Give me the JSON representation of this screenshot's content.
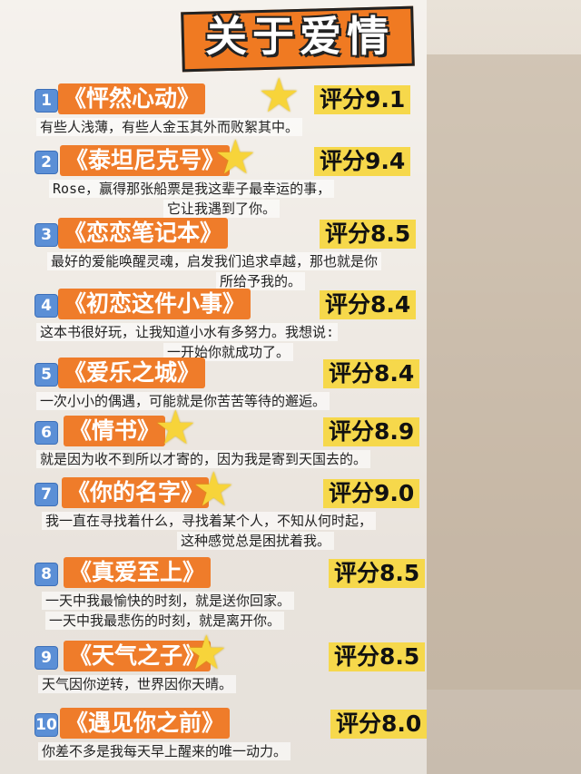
{
  "title": "关于爱情",
  "colors": {
    "accent": "#ef7c2a",
    "score_bg": "#f6d84b",
    "number_badge": "#5b8fd6"
  },
  "movies": [
    {
      "num": "1",
      "name": "《怦然心动》",
      "score": "评分9.1",
      "star": true,
      "lines": [
        "有些人浅薄，有些人金玉其外而败絮其中。"
      ]
    },
    {
      "num": "2",
      "name": "《泰坦尼克号》",
      "score": "评分9.4",
      "star": true,
      "lines": [
        "Rose，赢得那张船票是我这辈子最幸运的事，",
        "它让我遇到了你。"
      ]
    },
    {
      "num": "3",
      "name": "《恋恋笔记本》",
      "score": "评分8.5",
      "star": false,
      "lines": [
        "最好的爱能唤醒灵魂，启发我们追求卓越，那也就是你",
        "所给予我的。"
      ]
    },
    {
      "num": "4",
      "name": "《初恋这件小事》",
      "score": "评分8.4",
      "star": false,
      "lines": [
        "这本书很好玩，让我知道小水有多努力。我想说:",
        "一开始你就成功了。"
      ]
    },
    {
      "num": "5",
      "name": "《爱乐之城》",
      "score": "评分8.4",
      "star": false,
      "lines": [
        "一次小小的偶遇，可能就是你苦苦等待的邂逅。"
      ]
    },
    {
      "num": "6",
      "name": "《情书》",
      "score": "评分8.9",
      "star": true,
      "lines": [
        "就是因为收不到所以才寄的，因为我是寄到天国去的。"
      ]
    },
    {
      "num": "7",
      "name": "《你的名字》",
      "score": "评分9.0",
      "star": true,
      "lines": [
        "我一直在寻找着什么，寻找着某个人，不知从何时起，",
        "这种感觉总是困扰着我。"
      ]
    },
    {
      "num": "8",
      "name": "《真爱至上》",
      "score": "评分8.5",
      "star": false,
      "lines": [
        "一天中我最愉快的时刻，就是送你回家。",
        "一天中我最悲伤的时刻，就是离开你。"
      ]
    },
    {
      "num": "9",
      "name": "《天气之子》",
      "score": "评分8.5",
      "star": true,
      "lines": [
        "天气因你逆转，世界因你天晴。"
      ]
    },
    {
      "num": "10",
      "name": "《遇见你之前》",
      "score": "评分8.0",
      "star": false,
      "lines": [
        "你差不多是我每天早上醒来的唯一动力。"
      ]
    }
  ]
}
